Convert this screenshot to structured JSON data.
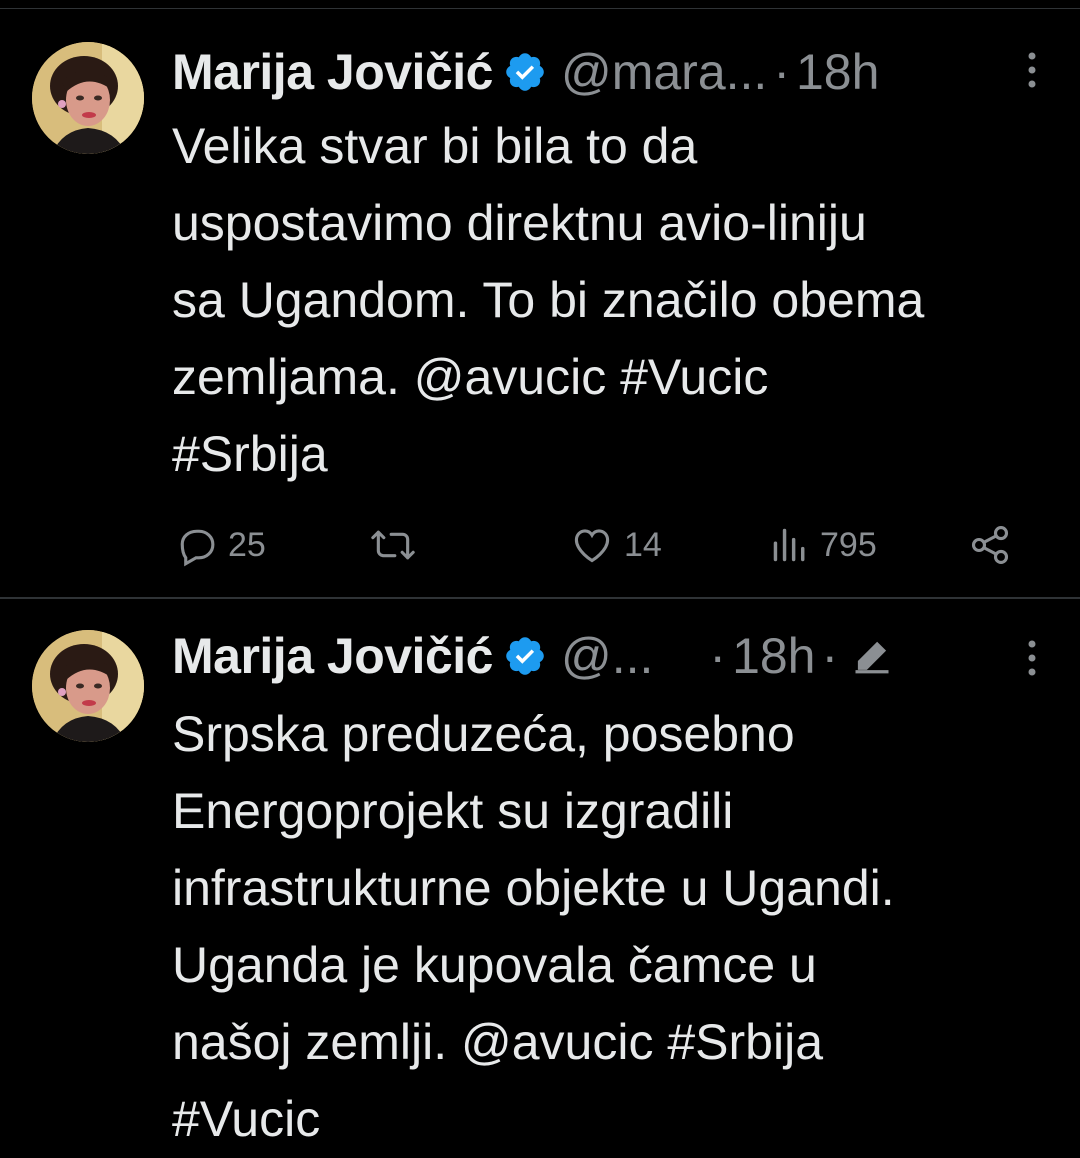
{
  "tweets": [
    {
      "author_name": "Marija Jovičić",
      "handle": "@mara...",
      "separator": "·",
      "time": "18h",
      "text": "Velika stvar bi bila to da\nuspostavimo direktnu avio-liniju\nsa Ugandom. To bi značilo obema\nzemljama. @avucic #Vucic\n#Srbija",
      "replies": "25",
      "retweets": "",
      "likes": "14",
      "views": "795",
      "edited": false
    },
    {
      "author_name": "Marija Jovičić",
      "handle": "@...",
      "separator": "·",
      "time": "18h",
      "separator2": "·",
      "text": "Srpska preduzeća, posebno\nEnergoprojekt su izgradili\ninfrastrukturne objekte u Ugandi.\nUganda je kupovala čamce u\nnašoj zemlji. @avucic #Srbija\n#Vucic",
      "edited": true
    }
  ],
  "icons": {
    "verified": "verified-badge-icon",
    "more": "more-vertical-icon",
    "reply": "reply-icon",
    "retweet": "retweet-icon",
    "like": "heart-icon",
    "views": "views-icon",
    "share": "share-icon",
    "edit": "edit-pencil-icon"
  },
  "colors": {
    "background": "#000000",
    "text": "#e7e9ea",
    "secondary": "#8b8f93",
    "verified": "#1d9bf0",
    "divider": "#2f3336"
  }
}
